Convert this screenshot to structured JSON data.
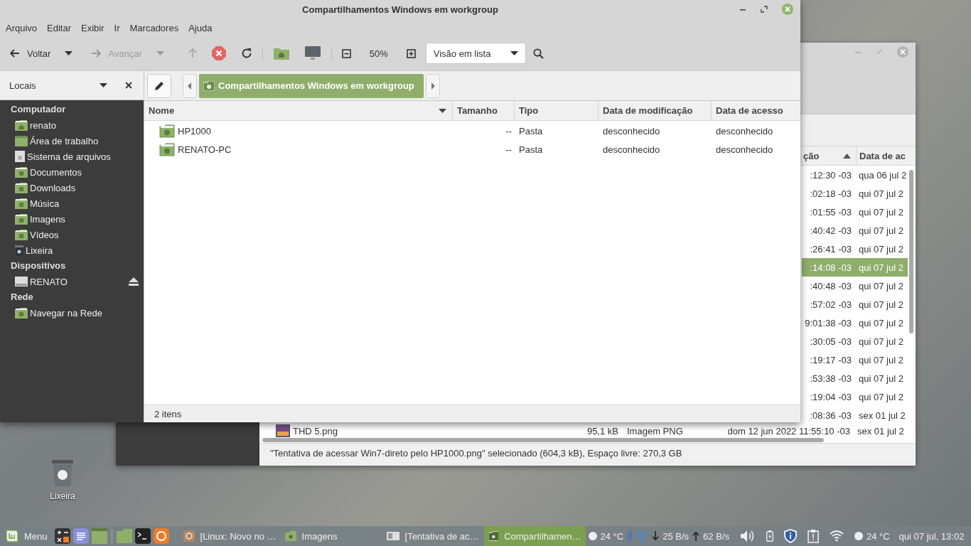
{
  "front_window": {
    "title": "Compartilhamentos Windows em workgroup",
    "menu": [
      "Arquivo",
      "Editar",
      "Exibir",
      "Ir",
      "Marcadores",
      "Ajuda"
    ],
    "toolbar": {
      "back": {
        "label": "Voltar",
        "disabled": false
      },
      "forward": {
        "label": "Avançar",
        "disabled": true
      },
      "zoom": "50%",
      "view": "Visão em lista"
    },
    "sidebar": {
      "title": "Locais",
      "sections": [
        {
          "title": "Computador",
          "items": [
            {
              "label": "renato",
              "kind": "home",
              "eject": false
            },
            {
              "label": "Área de trabalho",
              "kind": "desktop",
              "eject": false
            },
            {
              "label": "Sistema de arquivos",
              "kind": "drive",
              "eject": false
            },
            {
              "label": "Documentos",
              "kind": "documents",
              "eject": false
            },
            {
              "label": "Downloads",
              "kind": "downloads",
              "eject": false
            },
            {
              "label": "Música",
              "kind": "music",
              "eject": false
            },
            {
              "label": "Imagens",
              "kind": "pictures",
              "eject": false
            },
            {
              "label": "Vídeos",
              "kind": "videos",
              "eject": false
            },
            {
              "label": "Lixeira",
              "kind": "trash",
              "eject": false
            }
          ]
        },
        {
          "title": "Dispositivos",
          "items": [
            {
              "label": "RENATO",
              "kind": "device",
              "eject": true
            }
          ]
        },
        {
          "title": "Rede",
          "items": [
            {
              "label": "Navegar na Rede",
              "kind": "network",
              "eject": false
            }
          ]
        }
      ]
    },
    "location": "Compartilhamentos Windows em workgroup",
    "columns": [
      "Nome",
      "Tamanho",
      "Tipo",
      "Data de modificação",
      "Data de acesso"
    ],
    "rows": [
      {
        "name": "HP1000",
        "size": "--",
        "type": "Pasta",
        "modified": "desconhecido",
        "accessed": "desconhecido"
      },
      {
        "name": "RENATO-PC",
        "size": "--",
        "type": "Pasta",
        "modified": "desconhecido",
        "accessed": "desconhecido"
      }
    ],
    "status": "2 itens"
  },
  "back_window": {
    "columns": [
      "ção",
      "Data de ac"
    ],
    "rows": [
      {
        "modified": ":12:30 -03",
        "accessed": "qua 06 jul 2",
        "selected": false
      },
      {
        "modified": ":02:18 -03",
        "accessed": "qui 07 jul 2",
        "selected": false
      },
      {
        "modified": ":01:55 -03",
        "accessed": "qui 07 jul 2",
        "selected": false
      },
      {
        "modified": ":40:42 -03",
        "accessed": "qui 07 jul 2",
        "selected": false
      },
      {
        "modified": ":26:41 -03",
        "accessed": "qui 07 jul 2",
        "selected": false
      },
      {
        "modified": ":14:08 -03",
        "accessed": "qui 07 jul 2",
        "selected": true
      },
      {
        "modified": ":40:48 -03",
        "accessed": "qui 07 jul 2",
        "selected": false
      },
      {
        "modified": ":57:02 -03",
        "accessed": "qui 07 jul 2",
        "selected": false
      },
      {
        "modified": "9:01:38 -03",
        "accessed": "qui 07 jul 2",
        "selected": false
      },
      {
        "modified": ":30:05 -03",
        "accessed": "qui 07 jul 2",
        "selected": false
      },
      {
        "modified": ":19:17 -03",
        "accessed": "qui 07 jul 2",
        "selected": false
      },
      {
        "modified": ":53:38 -03",
        "accessed": "qui 07 jul 2",
        "selected": false
      },
      {
        "modified": ":19:04 -03",
        "accessed": "qui 07 jul 2",
        "selected": false
      },
      {
        "modified": ":08:36 -03",
        "accessed": "sex 01 jul 2",
        "selected": false
      },
      {
        "name": "THD 5.png",
        "size": "95,1 kB",
        "type": "Imagem PNG",
        "modified": "dom 12 jun 2022 11:55:10 -03",
        "accessed": "sex 01 jul 2",
        "selected": false
      }
    ],
    "status": "\"Tentativa de acessar Win7-direto pelo HP1000.png\" selecionado (604,3 kB), Espaço livre: 270,3 GB"
  },
  "desktop_icons": [
    {
      "label": "Lixeira"
    }
  ],
  "taskbar": {
    "menu": "Menu",
    "windows": [
      {
        "title": "[Linux: Novo no …",
        "kind": "browser",
        "selected": false
      },
      {
        "title": "Imagens",
        "kind": "folder",
        "selected": false
      },
      {
        "title": "[Tentativa de ac…",
        "kind": "image",
        "selected": false
      },
      {
        "title": "Compartilhamen…",
        "kind": "network",
        "selected": true
      }
    ],
    "temperature": "24 °C",
    "download": "25 B/s",
    "upload": "62 B/s",
    "temperature_2": "24 °C",
    "clock": "qui 07 jul, 13:02"
  }
}
